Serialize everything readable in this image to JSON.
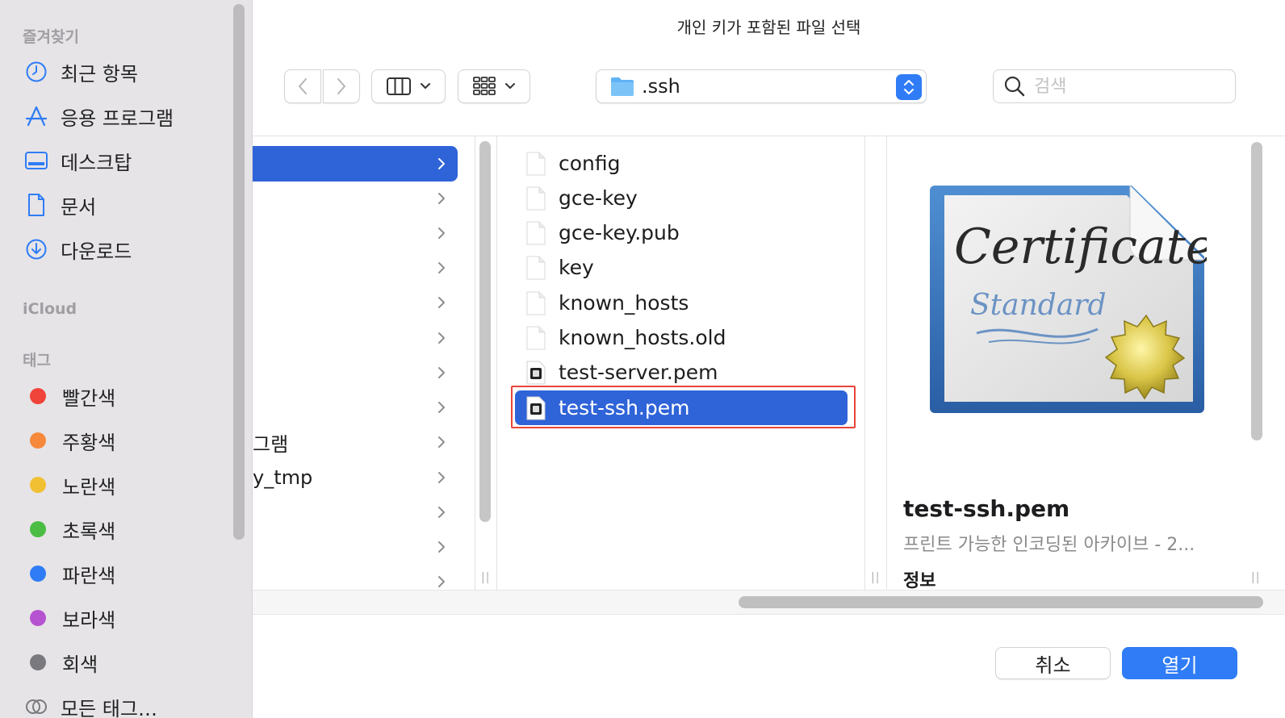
{
  "dialog": {
    "title": "개인 키가 포함된 파일 선택"
  },
  "sidebar": {
    "favorites_label": "즐겨찾기",
    "favorites": [
      {
        "label": "최근 항목",
        "icon": "clock-icon"
      },
      {
        "label": "응용 프로그램",
        "icon": "applications-icon"
      },
      {
        "label": "데스크탑",
        "icon": "desktop-icon"
      },
      {
        "label": "문서",
        "icon": "document-icon"
      },
      {
        "label": "다운로드",
        "icon": "download-icon"
      }
    ],
    "icloud_label": "iCloud",
    "tags_label": "태그",
    "tags": [
      {
        "label": "빨간색",
        "color": "#f0443a"
      },
      {
        "label": "주황색",
        "color": "#f5883a"
      },
      {
        "label": "노란색",
        "color": "#f2c033"
      },
      {
        "label": "초록색",
        "color": "#4bbd44"
      },
      {
        "label": "파란색",
        "color": "#2f7cf6"
      },
      {
        "label": "보라색",
        "color": "#b653d1"
      },
      {
        "label": "회색",
        "color": "#7a7a7e"
      },
      {
        "label": "모든 태그…",
        "icon": "all-tags-icon"
      }
    ]
  },
  "toolbar": {
    "location": ".ssh",
    "search_placeholder": "검색",
    "accent": "#2f7cf6"
  },
  "column1": {
    "rows": [
      {
        "label": "",
        "selected": true
      },
      {
        "label": ""
      },
      {
        "label": ""
      },
      {
        "label": ""
      },
      {
        "label": ""
      },
      {
        "label": ""
      },
      {
        "label": ""
      },
      {
        "label": ""
      },
      {
        "label": "그램"
      },
      {
        "label": "y_tmp"
      },
      {
        "label": ""
      },
      {
        "label": ""
      },
      {
        "label": ""
      }
    ]
  },
  "column2": {
    "files": [
      {
        "name": "config",
        "icon": "blank-file-icon"
      },
      {
        "name": "gce-key",
        "icon": "blank-file-icon"
      },
      {
        "name": "gce-key.pub",
        "icon": "blank-file-icon"
      },
      {
        "name": "key",
        "icon": "blank-file-icon"
      },
      {
        "name": "known_hosts",
        "icon": "blank-file-icon"
      },
      {
        "name": "known_hosts.old",
        "icon": "blank-file-icon"
      },
      {
        "name": "test-server.pem",
        "icon": "pem-file-icon"
      },
      {
        "name": "test-ssh.pem",
        "icon": "pem-file-icon",
        "selected": true
      }
    ]
  },
  "preview": {
    "name": "test-ssh.pem",
    "kind": "프린트 가능한 인코딩된 아카이브 - 2...",
    "info_label": "정보",
    "certificate_script_line1": "Certificate",
    "certificate_script_line2": "Standard"
  },
  "buttons": {
    "cancel": "취소",
    "open": "열기"
  }
}
